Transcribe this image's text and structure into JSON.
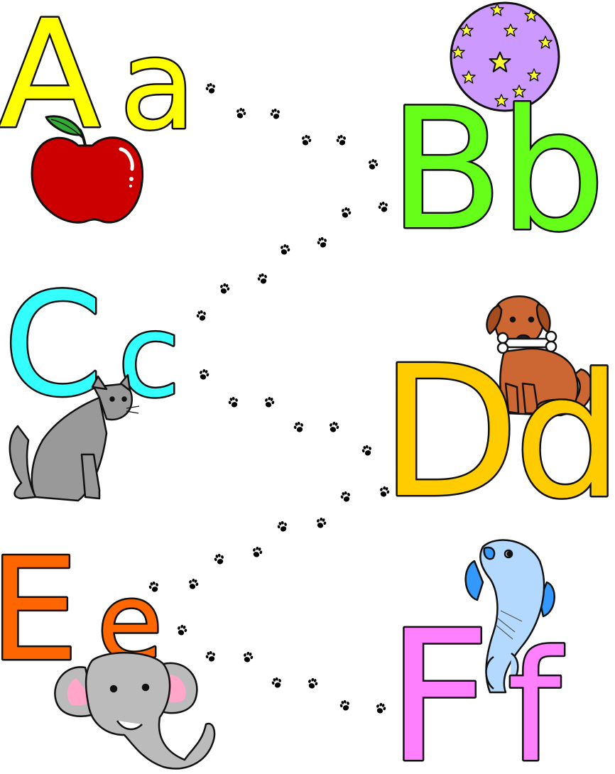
{
  "pairs": [
    {
      "upper": "A",
      "lower": "a",
      "color": "#ffff00",
      "picture": "apple-icon"
    },
    {
      "upper": "B",
      "lower": "b",
      "color": "#66ff1a",
      "picture": "star-ball-icon"
    },
    {
      "upper": "C",
      "lower": "c",
      "color": "#33ffff",
      "picture": "cat-icon"
    },
    {
      "upper": "D",
      "lower": "d",
      "color": "#ffcc00",
      "picture": "dog-icon"
    },
    {
      "upper": "E",
      "lower": "e",
      "color": "#ff6600",
      "picture": "elephant-icon"
    },
    {
      "upper": "F",
      "lower": "f",
      "color": "#ff80ff",
      "picture": "fish-icon"
    }
  ],
  "trail_icon": "paw-print-icon",
  "outline_color": "#111111"
}
